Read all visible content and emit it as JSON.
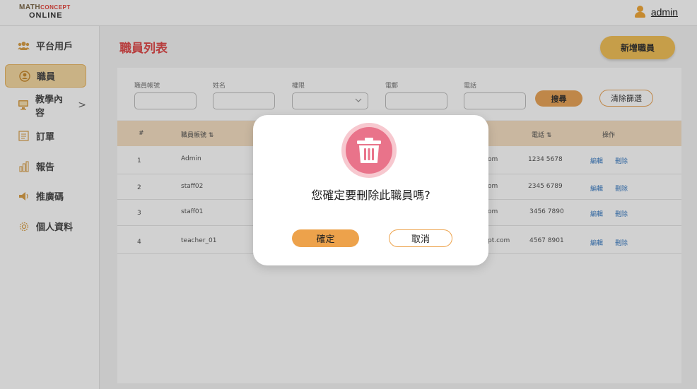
{
  "topbar": {
    "logo_line1_a": "MATH",
    "logo_line1_b": "CONCEPT",
    "logo_line2": "ONLINE",
    "user_name": "admin",
    "user_icon": "user-icon"
  },
  "sidebar": {
    "items": [
      {
        "label": "平台用戶",
        "icon": "users-icon"
      },
      {
        "label": "職員",
        "icon": "user-circle-icon"
      },
      {
        "label": "教學內容",
        "icon": "monitor-icon",
        "chevron": ">"
      },
      {
        "label": "訂單",
        "icon": "list-icon"
      },
      {
        "label": "報告",
        "icon": "bar-chart-icon"
      },
      {
        "label": "推廣碼",
        "icon": "megaphone-icon"
      },
      {
        "label": "個人資料",
        "icon": "gear-icon"
      }
    ]
  },
  "main": {
    "title": "職員列表",
    "add_button": "新增職員"
  },
  "filters": {
    "fields": [
      "職員帳號",
      "姓名",
      "權限",
      "電郵",
      "電話"
    ],
    "search_button": "搜尋",
    "clear_button": "清除篩選"
  },
  "table": {
    "headers": [
      "#",
      "職員帳號 ⇅",
      "電話 ⇅",
      "操作"
    ],
    "rows": [
      {
        "num": "1",
        "account": "Admin",
        "email_tail": "om",
        "phone": "1234 5678",
        "edit": "編輯",
        "delete": "刪除"
      },
      {
        "num": "2",
        "account": "staff02",
        "email_tail": "om",
        "phone": "2345 6789",
        "edit": "編輯",
        "delete": "刪除"
      },
      {
        "num": "3",
        "account": "staff01",
        "email_tail": "om",
        "phone": "3456 7890",
        "edit": "編輯",
        "delete": "刪除"
      },
      {
        "num": "4",
        "account": "teacher_01",
        "email_tail": "pt.com",
        "phone": "4567 8901",
        "edit": "編輯",
        "delete": "刪除"
      }
    ]
  },
  "modal": {
    "icon": "trash-icon",
    "message": "您確定要刪除此職員嗎?",
    "confirm": "確定",
    "cancel": "取消"
  },
  "colors": {
    "accent": "#f2c15a",
    "title_red": "#e04b4b",
    "danger_pink": "#e9738a",
    "link_blue": "#3c7dc4"
  }
}
